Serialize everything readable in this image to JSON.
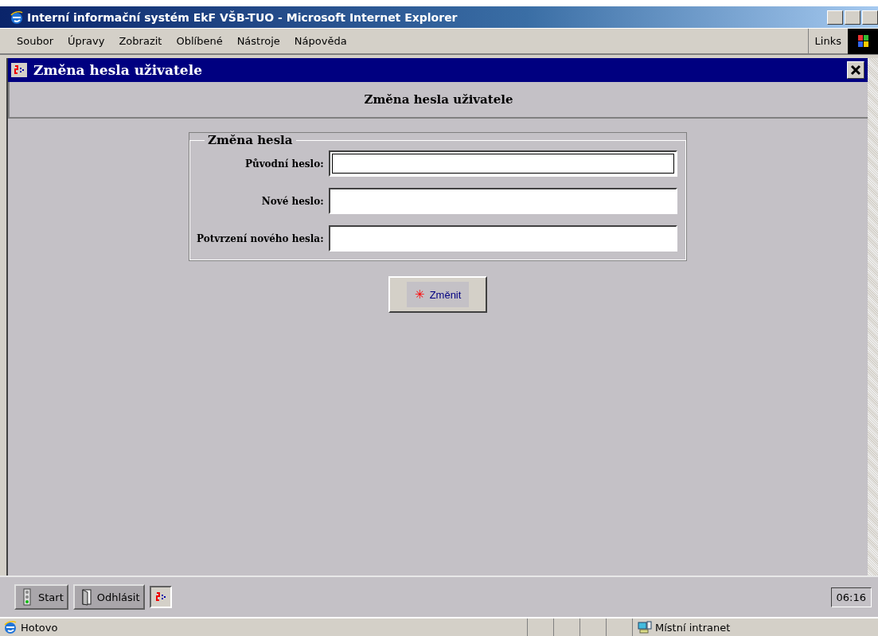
{
  "browser": {
    "title": "Interní informační systém EkF VŠB-TUO - Microsoft Internet Explorer",
    "menu": [
      {
        "label": "Soubor"
      },
      {
        "label": "Úpravy"
      },
      {
        "label": "Zobrazit"
      },
      {
        "label": "Oblíbené"
      },
      {
        "label": "Nástroje"
      },
      {
        "label": "Nápověda"
      }
    ],
    "links": "Links"
  },
  "app_window": {
    "title": "Změna hesla uživatele",
    "heading": "Změna hesla uživatele",
    "form": {
      "legend": "Změna hesla",
      "fields": [
        {
          "label": "Původní heslo:",
          "focused": true
        },
        {
          "label": "Nové heslo:",
          "focused": false
        },
        {
          "label": "Potvrzení nového hesla:",
          "focused": false
        }
      ],
      "submit": {
        "icon": "✳",
        "label": "Změnit"
      }
    }
  },
  "taskbar": {
    "buttons": [
      {
        "kind": "start",
        "label": "Start"
      },
      {
        "kind": "logout",
        "label": "Odhlásit"
      },
      {
        "kind": "app"
      }
    ],
    "clock": "06:16"
  },
  "status_bar": {
    "text": "Hotovo",
    "zone": "Místní intranet"
  }
}
